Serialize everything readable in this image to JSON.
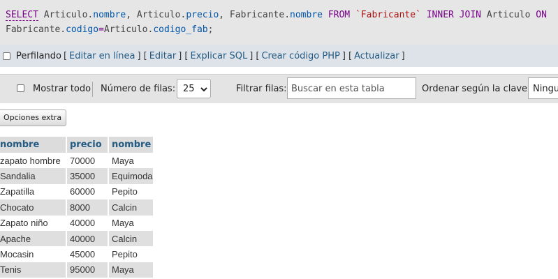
{
  "sql": {
    "line1": [
      {
        "t": "SELECT",
        "c": "kw u"
      },
      {
        "t": " Articulo.",
        "c": ""
      },
      {
        "t": "nombre",
        "c": "fld"
      },
      {
        "t": ", Articulo.",
        "c": ""
      },
      {
        "t": "precio",
        "c": "fld"
      },
      {
        "t": ", Fabricante.",
        "c": ""
      },
      {
        "t": "nombre",
        "c": "fld"
      },
      {
        "t": " ",
        "c": ""
      },
      {
        "t": "FROM",
        "c": "kw"
      },
      {
        "t": " ",
        "c": ""
      },
      {
        "t": "`Fabricante`",
        "c": "str"
      },
      {
        "t": " ",
        "c": ""
      },
      {
        "t": "INNER JOIN",
        "c": "kw"
      },
      {
        "t": " Articulo ",
        "c": ""
      },
      {
        "t": "ON",
        "c": "kw"
      }
    ],
    "line2": [
      {
        "t": "Fabricante.",
        "c": ""
      },
      {
        "t": "codigo",
        "c": "fld"
      },
      {
        "t": "=",
        "c": "kw"
      },
      {
        "t": "Articulo.",
        "c": ""
      },
      {
        "t": "codigo_fab",
        "c": "fld"
      },
      {
        "t": ";",
        "c": ""
      }
    ]
  },
  "profiling": {
    "label": "Perfilando",
    "links": [
      "Editar en línea",
      "Editar",
      "Explicar SQL",
      "Crear código PHP",
      "Actualizar"
    ]
  },
  "nav": {
    "show_all": "Mostrar todo",
    "rows_label": "Número de filas:",
    "rows_value": "25",
    "filter_label": "Filtrar filas:",
    "filter_placeholder": "Buscar en esta tabla",
    "order_label": "Ordenar según la clave:",
    "order_value": "Ninguna"
  },
  "extra_options": "Opciones extra",
  "table": {
    "headers": [
      "nombre",
      "precio",
      "nombre"
    ],
    "rows": [
      [
        "zapato hombre",
        "70000",
        "Maya"
      ],
      [
        "Sandalia",
        "35000",
        "Equimoda"
      ],
      [
        " Zapatilla",
        "60000",
        "Pepito"
      ],
      [
        " Chocato",
        "8000",
        "Calcin"
      ],
      [
        "Zapato niño",
        "40000",
        "Maya"
      ],
      [
        "Apache",
        "40000",
        "Calcin"
      ],
      [
        "Mocasin",
        "45000",
        "Pepito"
      ],
      [
        "Tenis",
        "95000",
        "Maya"
      ]
    ]
  },
  "icons": {
    "select_arrow": "chevron-down-icon",
    "checkbox": "checkbox-icon"
  }
}
